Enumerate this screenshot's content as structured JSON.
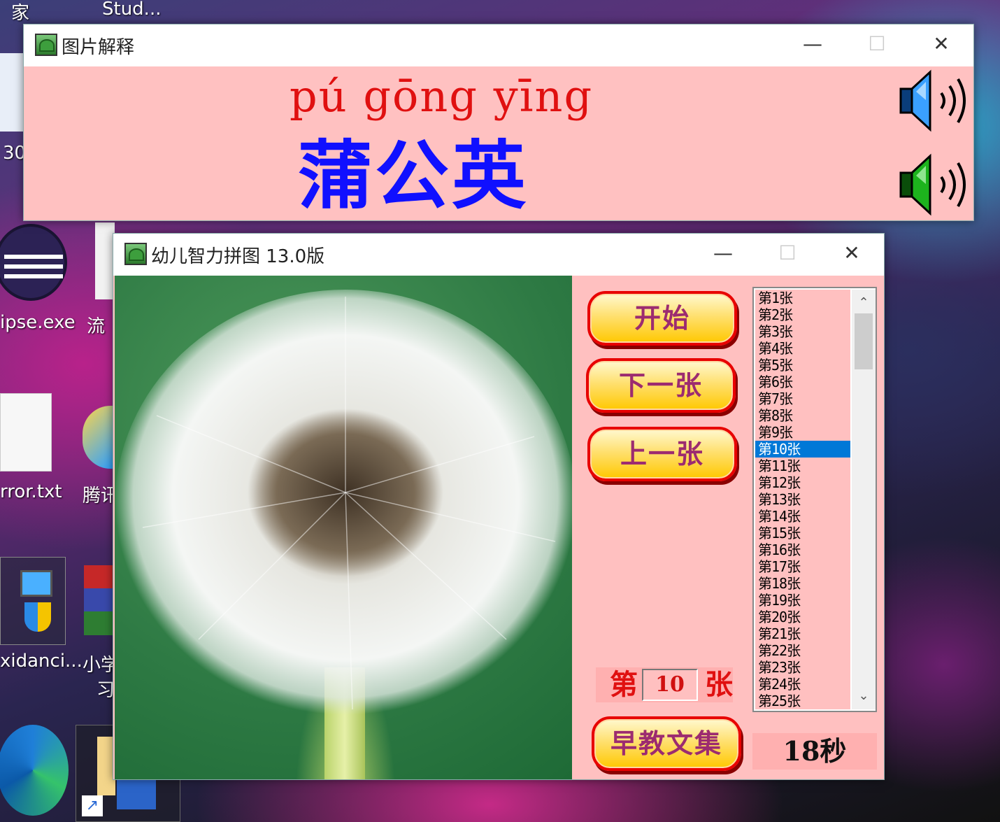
{
  "desktop": {
    "icons": [
      {
        "label": "家"
      },
      {
        "label": "Stud..."
      },
      {
        "label": "30"
      },
      {
        "label": "ipse.exe"
      },
      {
        "label": "流"
      },
      {
        "label": "rror.txt"
      },
      {
        "label": "腾讯"
      },
      {
        "label": "xidanci..."
      },
      {
        "label": "小学"
      },
      {
        "label": "习"
      }
    ]
  },
  "explain_window": {
    "title": "图片解释",
    "pinyin": "pú  gōng  yīng",
    "hanzi": "蒲公英",
    "controls": {
      "minimize": "—",
      "maximize": "☐",
      "close": "✕"
    },
    "speakers": [
      {
        "icon": "speaker-blue-icon",
        "color": "#1f8fff"
      },
      {
        "icon": "speaker-green-icon",
        "color": "#13a313"
      }
    ]
  },
  "puzzle_window": {
    "title": "幼儿智力拼图 13.0版",
    "controls": {
      "minimize": "—",
      "maximize": "☐",
      "close": "✕"
    },
    "buttons": {
      "start": "开始",
      "next": "下一张",
      "prev": "上一张",
      "collection": "早教文集"
    },
    "list": {
      "items": [
        "第1张",
        "第2张",
        "第3张",
        "第4张",
        "第5张",
        "第6张",
        "第7张",
        "第8张",
        "第9张",
        "第10张",
        "第11张",
        "第12张",
        "第13张",
        "第14张",
        "第15张",
        "第16张",
        "第17张",
        "第18张",
        "第19张",
        "第20张",
        "第21张",
        "第22张",
        "第23张",
        "第24张",
        "第25张"
      ],
      "selected_index": 9,
      "scroll_up": "⌃",
      "scroll_down": "⌄"
    },
    "counter": {
      "prefix": "第",
      "value": "10",
      "suffix": "张"
    },
    "timer": "18秒"
  },
  "colors": {
    "window_bg": "#ffc0c0",
    "pinyin": "#e01010",
    "hanzi": "#1010ff",
    "button_border": "#e80000",
    "button_text": "#9c2b70",
    "selection": "#0078d7"
  }
}
